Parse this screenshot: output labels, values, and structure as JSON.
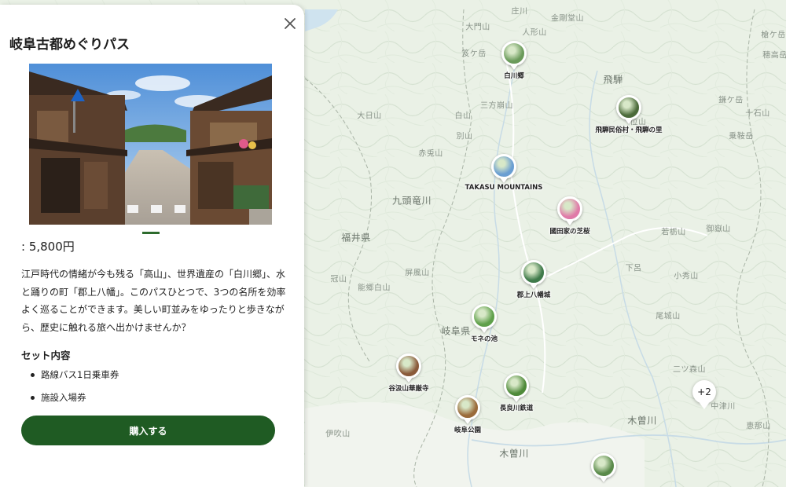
{
  "panel": {
    "title": "岐阜古都めぐりパス",
    "price": ": 5,800円",
    "description": "江戸時代の情緒が今も残る「高山」、世界遺産の「白川郷」、水と踊りの町「郡上八幡」。このパスひとつで、3つの名所を効率よく巡ることができます。美しい町並みをゆったりと歩きながら、歴史に触れる旅へ出かけませんか？",
    "set_title": "セット内容",
    "set_items": [
      "路線バス1日乗車券",
      "施設入場券"
    ],
    "buy_label": "購入する",
    "close_icon": "close-icon",
    "photo_icon": "old-town-street-photo"
  },
  "map": {
    "places": [
      "庄川",
      "金剛堂山",
      "大門山",
      "人形山",
      "笈ケ岳",
      "飛騨",
      "三方崩山",
      "大日山",
      "白山",
      "赤兎山",
      "別山",
      "九頭竜川",
      "福井県",
      "冠山",
      "能郷白山",
      "屏風山",
      "岐阜県",
      "若栃山",
      "御嶽山",
      "下呂",
      "小秀山",
      "尾城山",
      "二ツ森山",
      "中津川",
      "木曽川",
      "恵那山",
      "伊吹山",
      "木曽川",
      "槍ケ岳",
      "穂高岳",
      "乗鞍岳",
      "鎌ケ岳",
      "十石山",
      "位山"
    ],
    "spots": [
      {
        "label": "白川郷",
        "color": "#6a9a5a"
      },
      {
        "label": "飛騨民俗村・飛騨の里",
        "color": "#4b6a3a"
      },
      {
        "label": "TAKASU MOUNTAINS",
        "color": "#6a9ed2"
      },
      {
        "label": "國田家の芝桜",
        "color": "#e07aa8"
      },
      {
        "label": "郡上八幡城",
        "color": "#3f7a4a"
      },
      {
        "label": "モネの池",
        "color": "#5fa04a"
      },
      {
        "label": "谷汲山華厳寺",
        "color": "#8a5a3a"
      },
      {
        "label": "長良川鉄道",
        "color": "#4f8a3a"
      },
      {
        "label": "岐阜公園",
        "color": "#9a6a3a"
      },
      {
        "label": "",
        "color": "#5a8a4a"
      }
    ],
    "cluster_label": "+2"
  }
}
